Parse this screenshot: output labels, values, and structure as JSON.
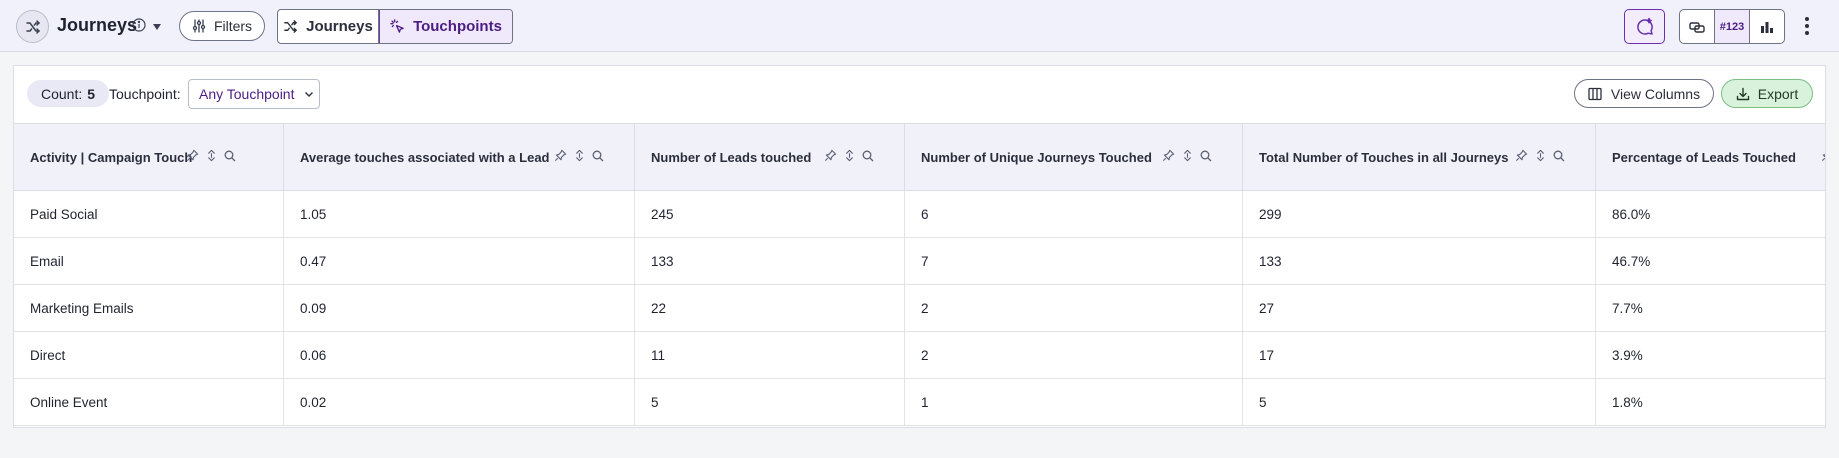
{
  "header": {
    "title": "Journeys",
    "filters_label": "Filters",
    "view_toggle": [
      {
        "label": "Journeys",
        "active": false
      },
      {
        "label": "Touchpoints",
        "active": true
      }
    ],
    "id_label": "#123"
  },
  "toolbar": {
    "count_label": "Count:",
    "count_value": "5",
    "touchpoint_label": "Touchpoint:",
    "touchpoint_value": "Any Touchpoint",
    "view_columns_label": "View Columns",
    "export_label": "Export"
  },
  "table": {
    "columns": [
      "Activity | Campaign Touch",
      "Average touches associated with a Lead",
      "Number of Leads touched",
      "Number of Unique Journeys Touched",
      "Total Number of Touches in all Journeys",
      "Percentage of Leads Touched"
    ],
    "rows": [
      [
        "Paid Social",
        "1.05",
        "245",
        "6",
        "299",
        "86.0%"
      ],
      [
        "Email",
        "0.47",
        "133",
        "7",
        "133",
        "46.7%"
      ],
      [
        "Marketing Emails",
        "0.09",
        "22",
        "2",
        "27",
        "7.7%"
      ],
      [
        "Direct",
        "0.06",
        "11",
        "2",
        "17",
        "3.9%"
      ],
      [
        "Online Event",
        "0.02",
        "5",
        "1",
        "5",
        "1.8%"
      ]
    ]
  },
  "colors": {
    "accent": "#4b1e84",
    "export_bg": "#d9f2dc",
    "header_bg": "#f1f1fb"
  }
}
